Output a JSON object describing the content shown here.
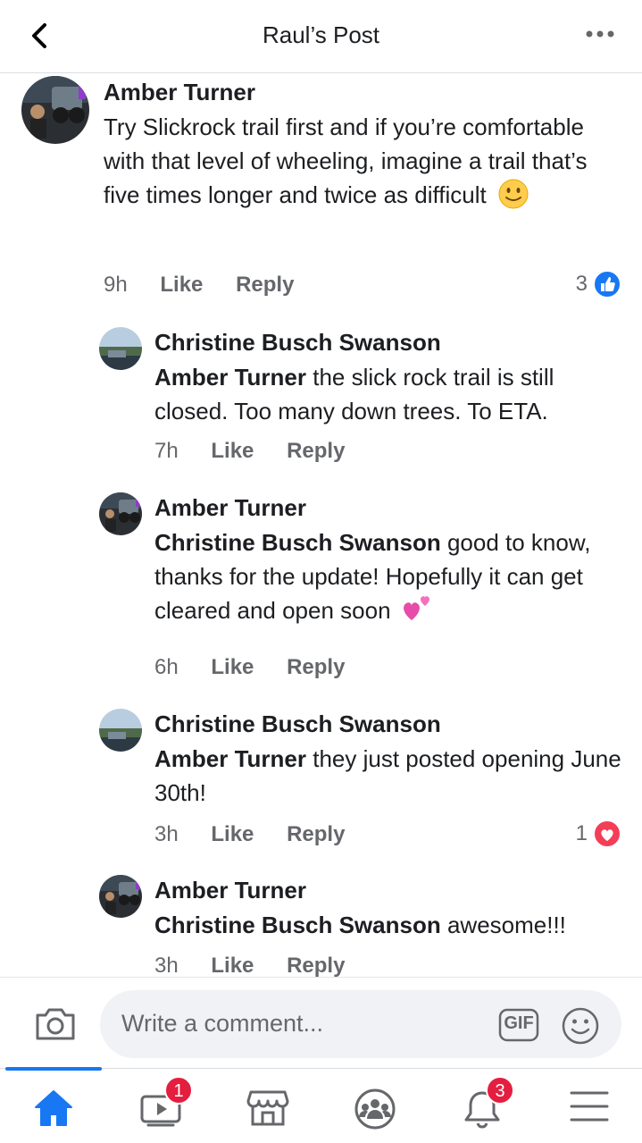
{
  "header": {
    "title": "Raul’s Post",
    "back_icon": "chevron-left-icon",
    "more_icon": "more-horizontal-icon"
  },
  "comments": [
    {
      "author": "Amber Turner",
      "text": "Try Slickrock trail first and if you’re comfortable with that level of wheeling, imagine a trail that’s five times longer and twice as difficult",
      "emoji": "slightly-smiling-face",
      "time": "9h",
      "like": "Like",
      "reply": "Reply",
      "reaction_count": "3",
      "reaction_type": "like"
    },
    {
      "author": "Christine Busch Swanson",
      "mention": "Amber Turner",
      "text": " the slick rock trail is still closed. Too many down trees.  To ETA.",
      "time": "7h",
      "like": "Like",
      "reply": "Reply"
    },
    {
      "author": "Amber Turner",
      "mention": "Christine Busch Swanson",
      "text": " good to know, thanks for the update! Hopefully it can get cleared and open soon",
      "emoji": "two-hearts",
      "time": "6h",
      "like": "Like",
      "reply": "Reply"
    },
    {
      "author": "Christine Busch Swanson",
      "mention": "Amber Turner",
      "text": " they just posted opening June 30th!",
      "time": "3h",
      "like": "Like",
      "reply": "Reply",
      "reaction_count": "1",
      "reaction_type": "love"
    },
    {
      "author": "Amber Turner",
      "mention": "Christine Busch Swanson",
      "text": " awesome!!!",
      "time": "3h",
      "like": "Like",
      "reply": "Reply"
    }
  ],
  "composer": {
    "placeholder": "Write a comment...",
    "gif_label": "GIF",
    "camera_icon": "camera-icon",
    "emoji_icon": "smiley-icon"
  },
  "bottom_nav": {
    "items": [
      {
        "name": "home-icon",
        "active": true
      },
      {
        "name": "watch-icon",
        "badge": "1"
      },
      {
        "name": "marketplace-icon"
      },
      {
        "name": "groups-icon"
      },
      {
        "name": "notifications-icon",
        "badge": "3"
      },
      {
        "name": "menu-icon"
      }
    ]
  },
  "colors": {
    "accent": "#1877f2",
    "badge": "#e41e3f",
    "secondary_text": "#65676b",
    "love": "#f33e58"
  }
}
